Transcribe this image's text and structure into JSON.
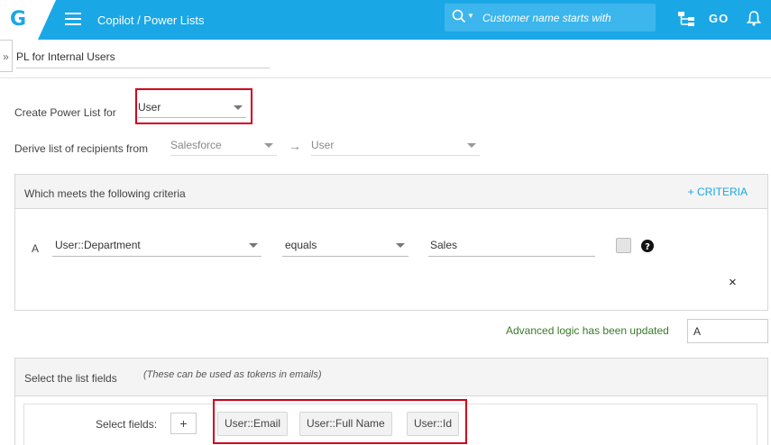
{
  "header": {
    "logo_letter": "G",
    "breadcrumb": "Copilot / Power Lists",
    "search_placeholder": "Customer name starts with",
    "go_label": "GO"
  },
  "power_list": {
    "name": "PL for Internal Users",
    "expand_glyph": "»",
    "create_for_label": "Create Power List for",
    "create_for_value": "User",
    "derive_label": "Derive list of recipients from",
    "derive_source": "Salesforce",
    "derive_arrow": "→",
    "derive_target": "User"
  },
  "criteria": {
    "title": "Which meets the following criteria",
    "add_link": "+ CRITERIA",
    "rows": [
      {
        "letter": "A",
        "field": "User::Department",
        "operator": "equals",
        "value": "Sales"
      }
    ],
    "remove_glyph": "×",
    "help_glyph": "?"
  },
  "advanced_logic": {
    "message": "Advanced logic has been updated",
    "value": "A"
  },
  "list_fields": {
    "title": "Select the list fields",
    "subtitle": "(These can be used as tokens in emails)",
    "select_label": "Select fields:",
    "add_glyph": "+",
    "chips": [
      "User::Email",
      "User::Full Name",
      "User::Id"
    ]
  },
  "colors": {
    "brand": "#1aa7e6",
    "highlight_border": "#d0021b",
    "success_text": "#3a7a2a"
  }
}
